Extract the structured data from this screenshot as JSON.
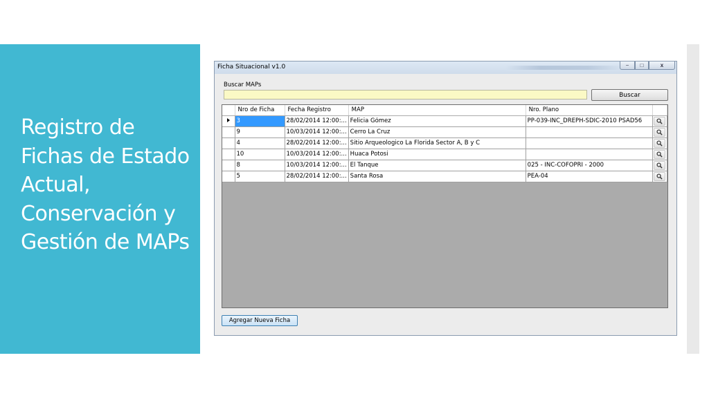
{
  "slide": {
    "title": "Registro de Fichas de Estado Actual, Conservación y Gestión de MAPs"
  },
  "window": {
    "title": "Ficha Situacional v1.0",
    "controls": {
      "minimize": "−",
      "maximize": "□",
      "close": "x"
    }
  },
  "search": {
    "label": "Buscar MAPs",
    "value": "",
    "placeholder": "",
    "button_label": "Buscar"
  },
  "grid": {
    "columns": [
      "Nro de Ficha",
      "Fecha Registro",
      "MAP",
      "Nro. Plano"
    ],
    "rows": [
      {
        "nro": "3",
        "fecha": "28/02/2014 12:00:...",
        "map": "Felicia Gómez",
        "plano": "PP-039-INC_DREPH-SDIC-2010 PSAD56",
        "current": true
      },
      {
        "nro": "9",
        "fecha": "10/03/2014 12:00:...",
        "map": "Cerro La Cruz",
        "plano": "",
        "current": false
      },
      {
        "nro": "4",
        "fecha": "28/02/2014 12:00:...",
        "map": "Sitio Arqueologico La Florida Sector A, B y C",
        "plano": "",
        "current": false
      },
      {
        "nro": "10",
        "fecha": "10/03/2014 12:00:...",
        "map": "Huaca Potosi",
        "plano": "",
        "current": false
      },
      {
        "nro": "8",
        "fecha": "10/03/2014 12:00:...",
        "map": "El Tanque",
        "plano": "025 - INC-COFOPRI - 2000",
        "current": false
      },
      {
        "nro": "5",
        "fecha": "28/02/2014 12:00:...",
        "map": "Santa Rosa",
        "plano": "PEA-04",
        "current": false
      }
    ],
    "row_action_icon": "magnifier-icon"
  },
  "footer": {
    "add_button_label": "Agregar Nueva Ficha"
  },
  "colors": {
    "accent_panel": "#41b8d2",
    "search_input_bg": "#fbf9c5",
    "selection": "#3399ff",
    "grid_empty_bg": "#ababab"
  }
}
